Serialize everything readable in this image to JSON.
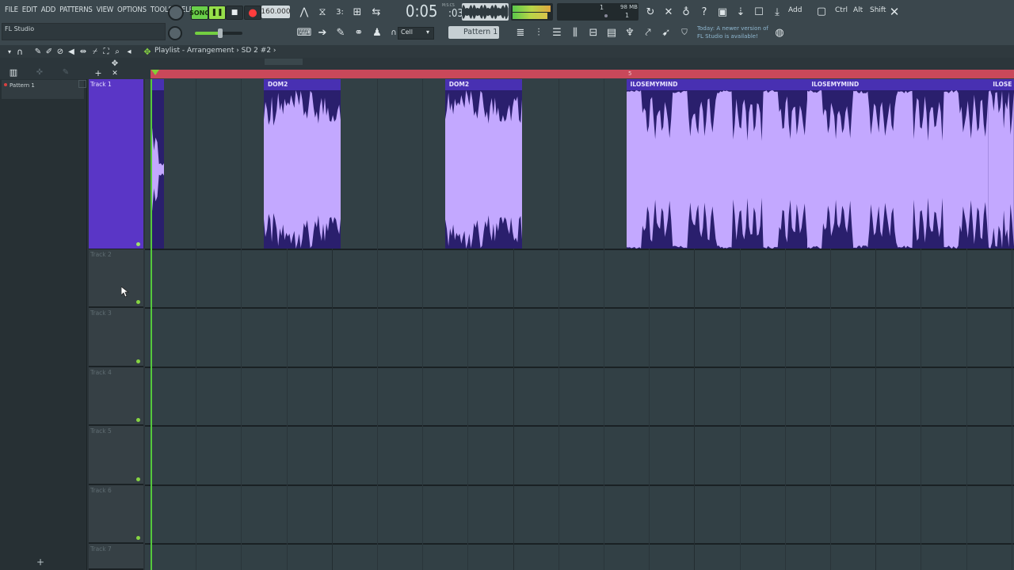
{
  "menu": [
    "FILE",
    "EDIT",
    "ADD",
    "PATTERNS",
    "VIEW",
    "OPTIONS",
    "TOOLS",
    "HELP"
  ],
  "hint_text": "FL Studio",
  "transport": {
    "mode_label": "SONG",
    "tempo": "160.000"
  },
  "time_display": {
    "main": "0:05",
    "sub": ":03",
    "label": "M:S:CS"
  },
  "cpu_panel": {
    "cpu": "1",
    "ram": "98 MB",
    "poly": "1"
  },
  "modifier_keys": [
    "Add",
    "Ctrl",
    "Alt",
    "Shift"
  ],
  "snap_mode": "Cell",
  "pattern_selector": "Pattern 1",
  "news": "Today: A newer version of FL Studio is available!",
  "playlist": {
    "title": "Playlist - Arrangement › SD 2 #2 ›",
    "timeline_marker": "5",
    "patterns": [
      "Pattern 1"
    ],
    "tracks": [
      "Track 1",
      "Track 2",
      "Track 3",
      "Track 4",
      "Track 5",
      "Track 6",
      "Track 7"
    ],
    "clips": [
      {
        "name": "",
        "start_bar": 1,
        "length_bars": 0.3,
        "wave": "sparse"
      },
      {
        "name": "DOM2",
        "start_bar": 3.5,
        "length_bars": 1.7,
        "wave": "dense"
      },
      {
        "name": "DOM2",
        "start_bar": 7.5,
        "length_bars": 1.7,
        "wave": "dense"
      },
      {
        "name": "ILOSEMYMIND",
        "start_bar": 11.5,
        "length_bars": 4,
        "wave": "loud"
      },
      {
        "name": "ILOSEMYMIND",
        "start_bar": 15.5,
        "length_bars": 4,
        "wave": "loud"
      },
      {
        "name": "ILOSE",
        "start_bar": 19.5,
        "length_bars": 1,
        "wave": "loud"
      }
    ]
  },
  "colors": {
    "clip_header": "#4830b2",
    "clip_body": "#2a1f6d",
    "waveform": "#c3a8ff",
    "track1": "#5a36c6",
    "playhead": "#55c83c",
    "loop_bar": "#c9485a"
  }
}
